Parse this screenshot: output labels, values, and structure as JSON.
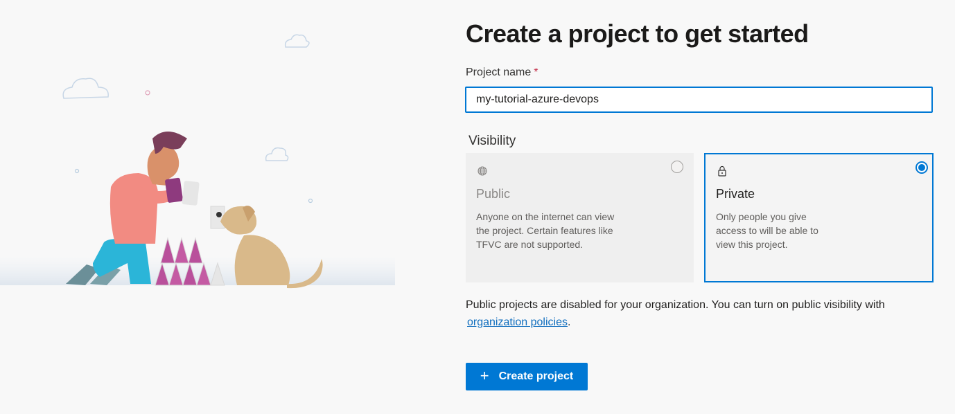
{
  "page": {
    "title": "Create a project to get started"
  },
  "form": {
    "name_label": "Project name",
    "required_marker": "*",
    "name_value": "my-tutorial-azure-devops",
    "visibility_label": "Visibility"
  },
  "visibility_options": [
    {
      "id": "public",
      "icon": "globe-icon",
      "title": "Public",
      "description": "Anyone on the internet can view the project. Certain features like TFVC are not supported.",
      "selected": false,
      "disabled": true
    },
    {
      "id": "private",
      "icon": "lock-icon",
      "title": "Private",
      "description": "Only people you give access to will be able to view this project.",
      "selected": true,
      "disabled": false
    }
  ],
  "notice": {
    "text": "Public projects are disabled for your organization. You can turn on public visibility with",
    "link_text": "organization policies",
    "suffix": "."
  },
  "actions": {
    "create_icon": "+",
    "create_label": "Create project"
  },
  "colors": {
    "accent": "#0078d4",
    "required": "#c4314b",
    "link": "#106ebe"
  }
}
